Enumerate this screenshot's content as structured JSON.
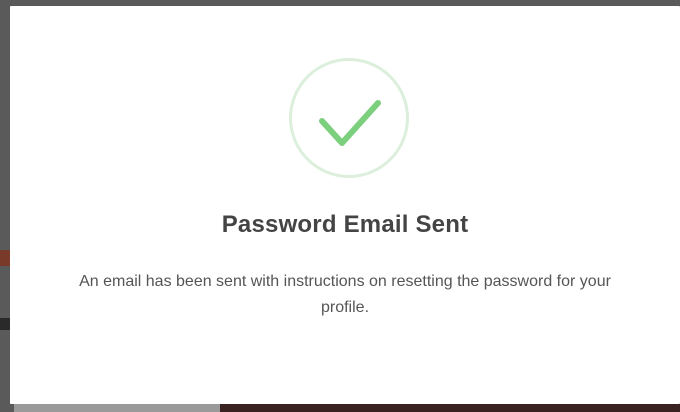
{
  "dialog": {
    "icon": "check-circle-icon",
    "title": "Password Email Sent",
    "message": "An email has been sent with instructions on resetting the password for your profile."
  },
  "colors": {
    "check_stroke": "#7ccf7c",
    "circle_border": "#dcefdc",
    "title_text": "#444444",
    "body_text": "#555555",
    "overlay": "#5a5a5a"
  }
}
